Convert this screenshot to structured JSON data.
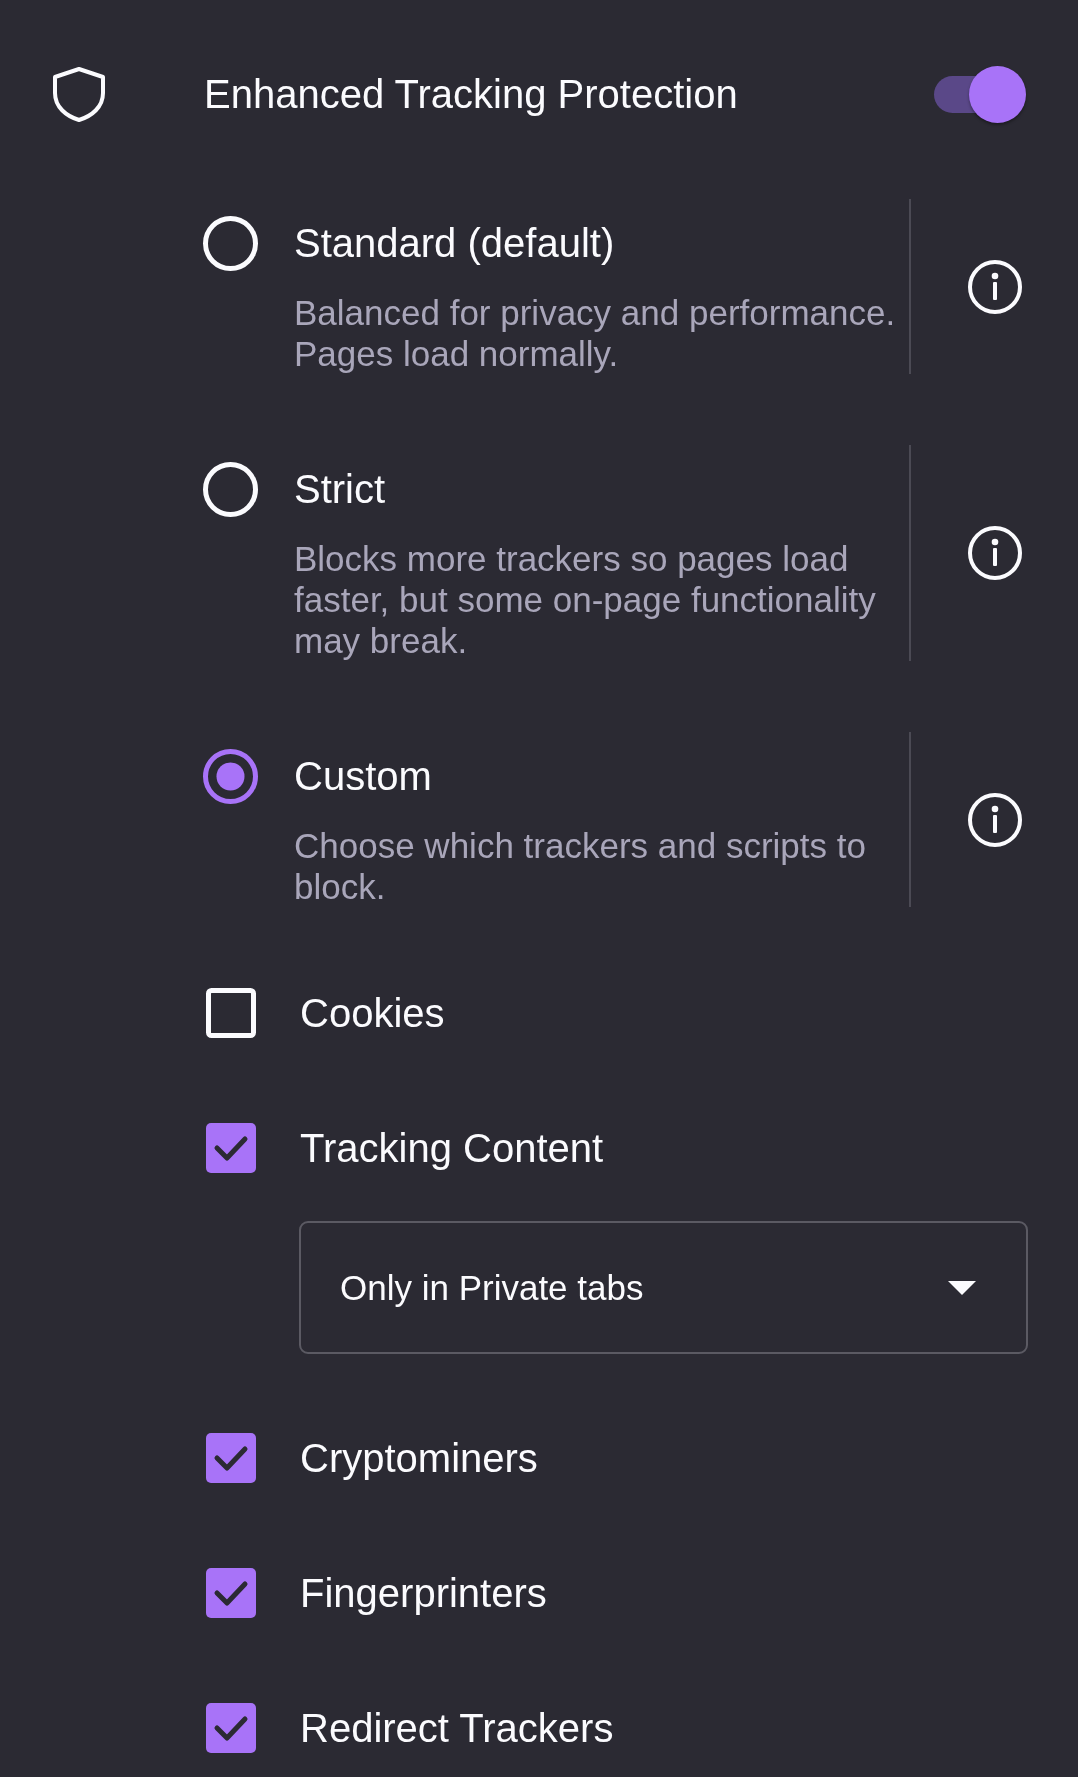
{
  "header": {
    "title": "Enhanced Tracking Protection",
    "enabled": true
  },
  "options": [
    {
      "label": "Standard (default)",
      "description": "Balanced for privacy and performance. Pages load normally.",
      "selected": false
    },
    {
      "label": "Strict",
      "description": "Blocks more trackers so pages load faster, but some on-page functionality may break.",
      "selected": false
    },
    {
      "label": "Custom",
      "description": "Choose which trackers and scripts to block.",
      "selected": true
    }
  ],
  "categories": [
    {
      "label": "Cookies",
      "checked": false
    },
    {
      "label": "Tracking Content",
      "checked": true,
      "dropdown": {
        "value": "Only in Private tabs"
      }
    },
    {
      "label": "Cryptominers",
      "checked": true
    },
    {
      "label": "Fingerprinters",
      "checked": true
    },
    {
      "label": "Redirect Trackers",
      "checked": true
    }
  ]
}
